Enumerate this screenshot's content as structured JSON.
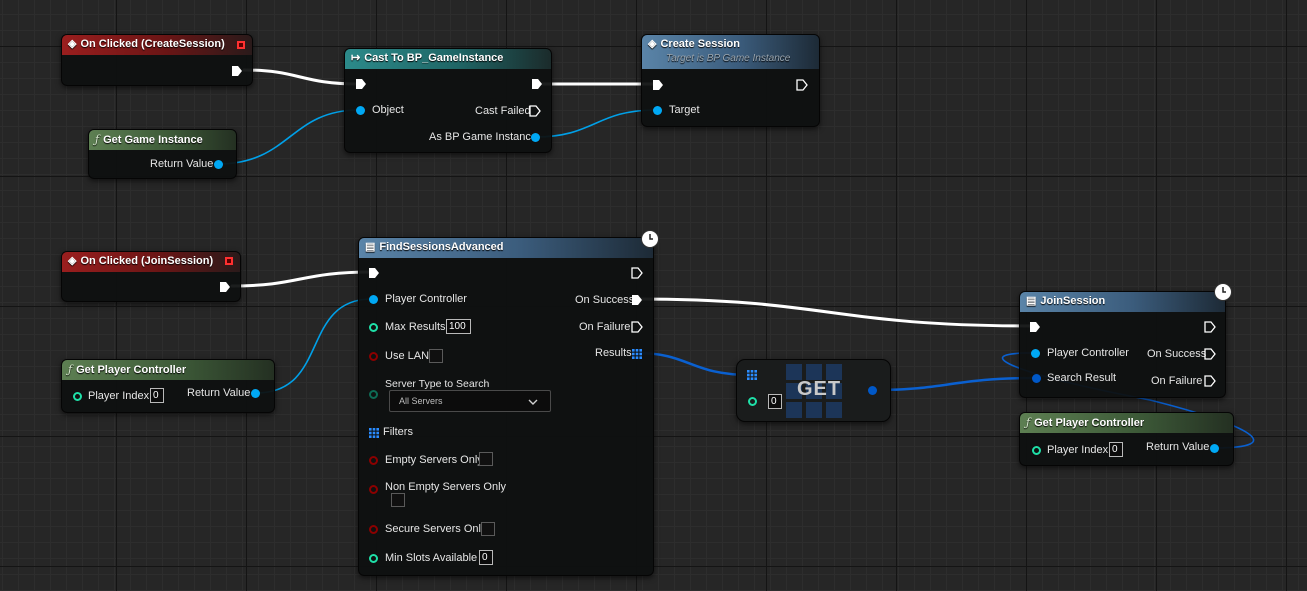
{
  "nodes": {
    "on_clicked_create": {
      "title": "On Clicked (CreateSession)"
    },
    "get_game_instance": {
      "title": "Get Game Instance",
      "return_value": "Return Value"
    },
    "cast": {
      "title": "Cast To BP_GameInstance",
      "object": "Object",
      "cast_failed": "Cast Failed",
      "as_bp": "As BP Game Instance"
    },
    "create_session": {
      "title": "Create Session",
      "subtitle": "Target is BP Game Instance",
      "target": "Target"
    },
    "on_clicked_join": {
      "title": "On Clicked (JoinSession)"
    },
    "get_player_controller_1": {
      "title": "Get Player Controller",
      "player_index": "Player Index",
      "index_value": "0",
      "return_value": "Return Value"
    },
    "find_sessions": {
      "title": "FindSessionsAdvanced",
      "player_controller": "Player Controller",
      "max_results": "Max Results",
      "max_results_value": "100",
      "use_lan": "Use LAN",
      "server_type": "Server Type to Search",
      "server_type_value": "All Servers",
      "filters": "Filters",
      "empty_servers": "Empty Servers Only",
      "non_empty_servers": "Non Empty Servers Only",
      "secure_servers": "Secure Servers Only",
      "min_slots": "Min Slots Available",
      "min_slots_value": "0",
      "on_success": "On Success",
      "on_failure": "On Failure",
      "results": "Results"
    },
    "get_node": {
      "title": "GET",
      "index_value": "0"
    },
    "join_session": {
      "title": "JoinSession",
      "player_controller": "Player Controller",
      "search_result": "Search Result",
      "on_success": "On Success",
      "on_failure": "On Failure"
    },
    "get_player_controller_2": {
      "title": "Get Player Controller",
      "player_index": "Player Index",
      "index_value": "0",
      "return_value": "Return Value"
    }
  },
  "colors": {
    "object_pin": "#00a8f4",
    "integer_pin": "#1fe0a8",
    "boolean_pin": "#8c0000",
    "struct_pin": "#0058c8",
    "exec_wire": "#ffffff"
  }
}
